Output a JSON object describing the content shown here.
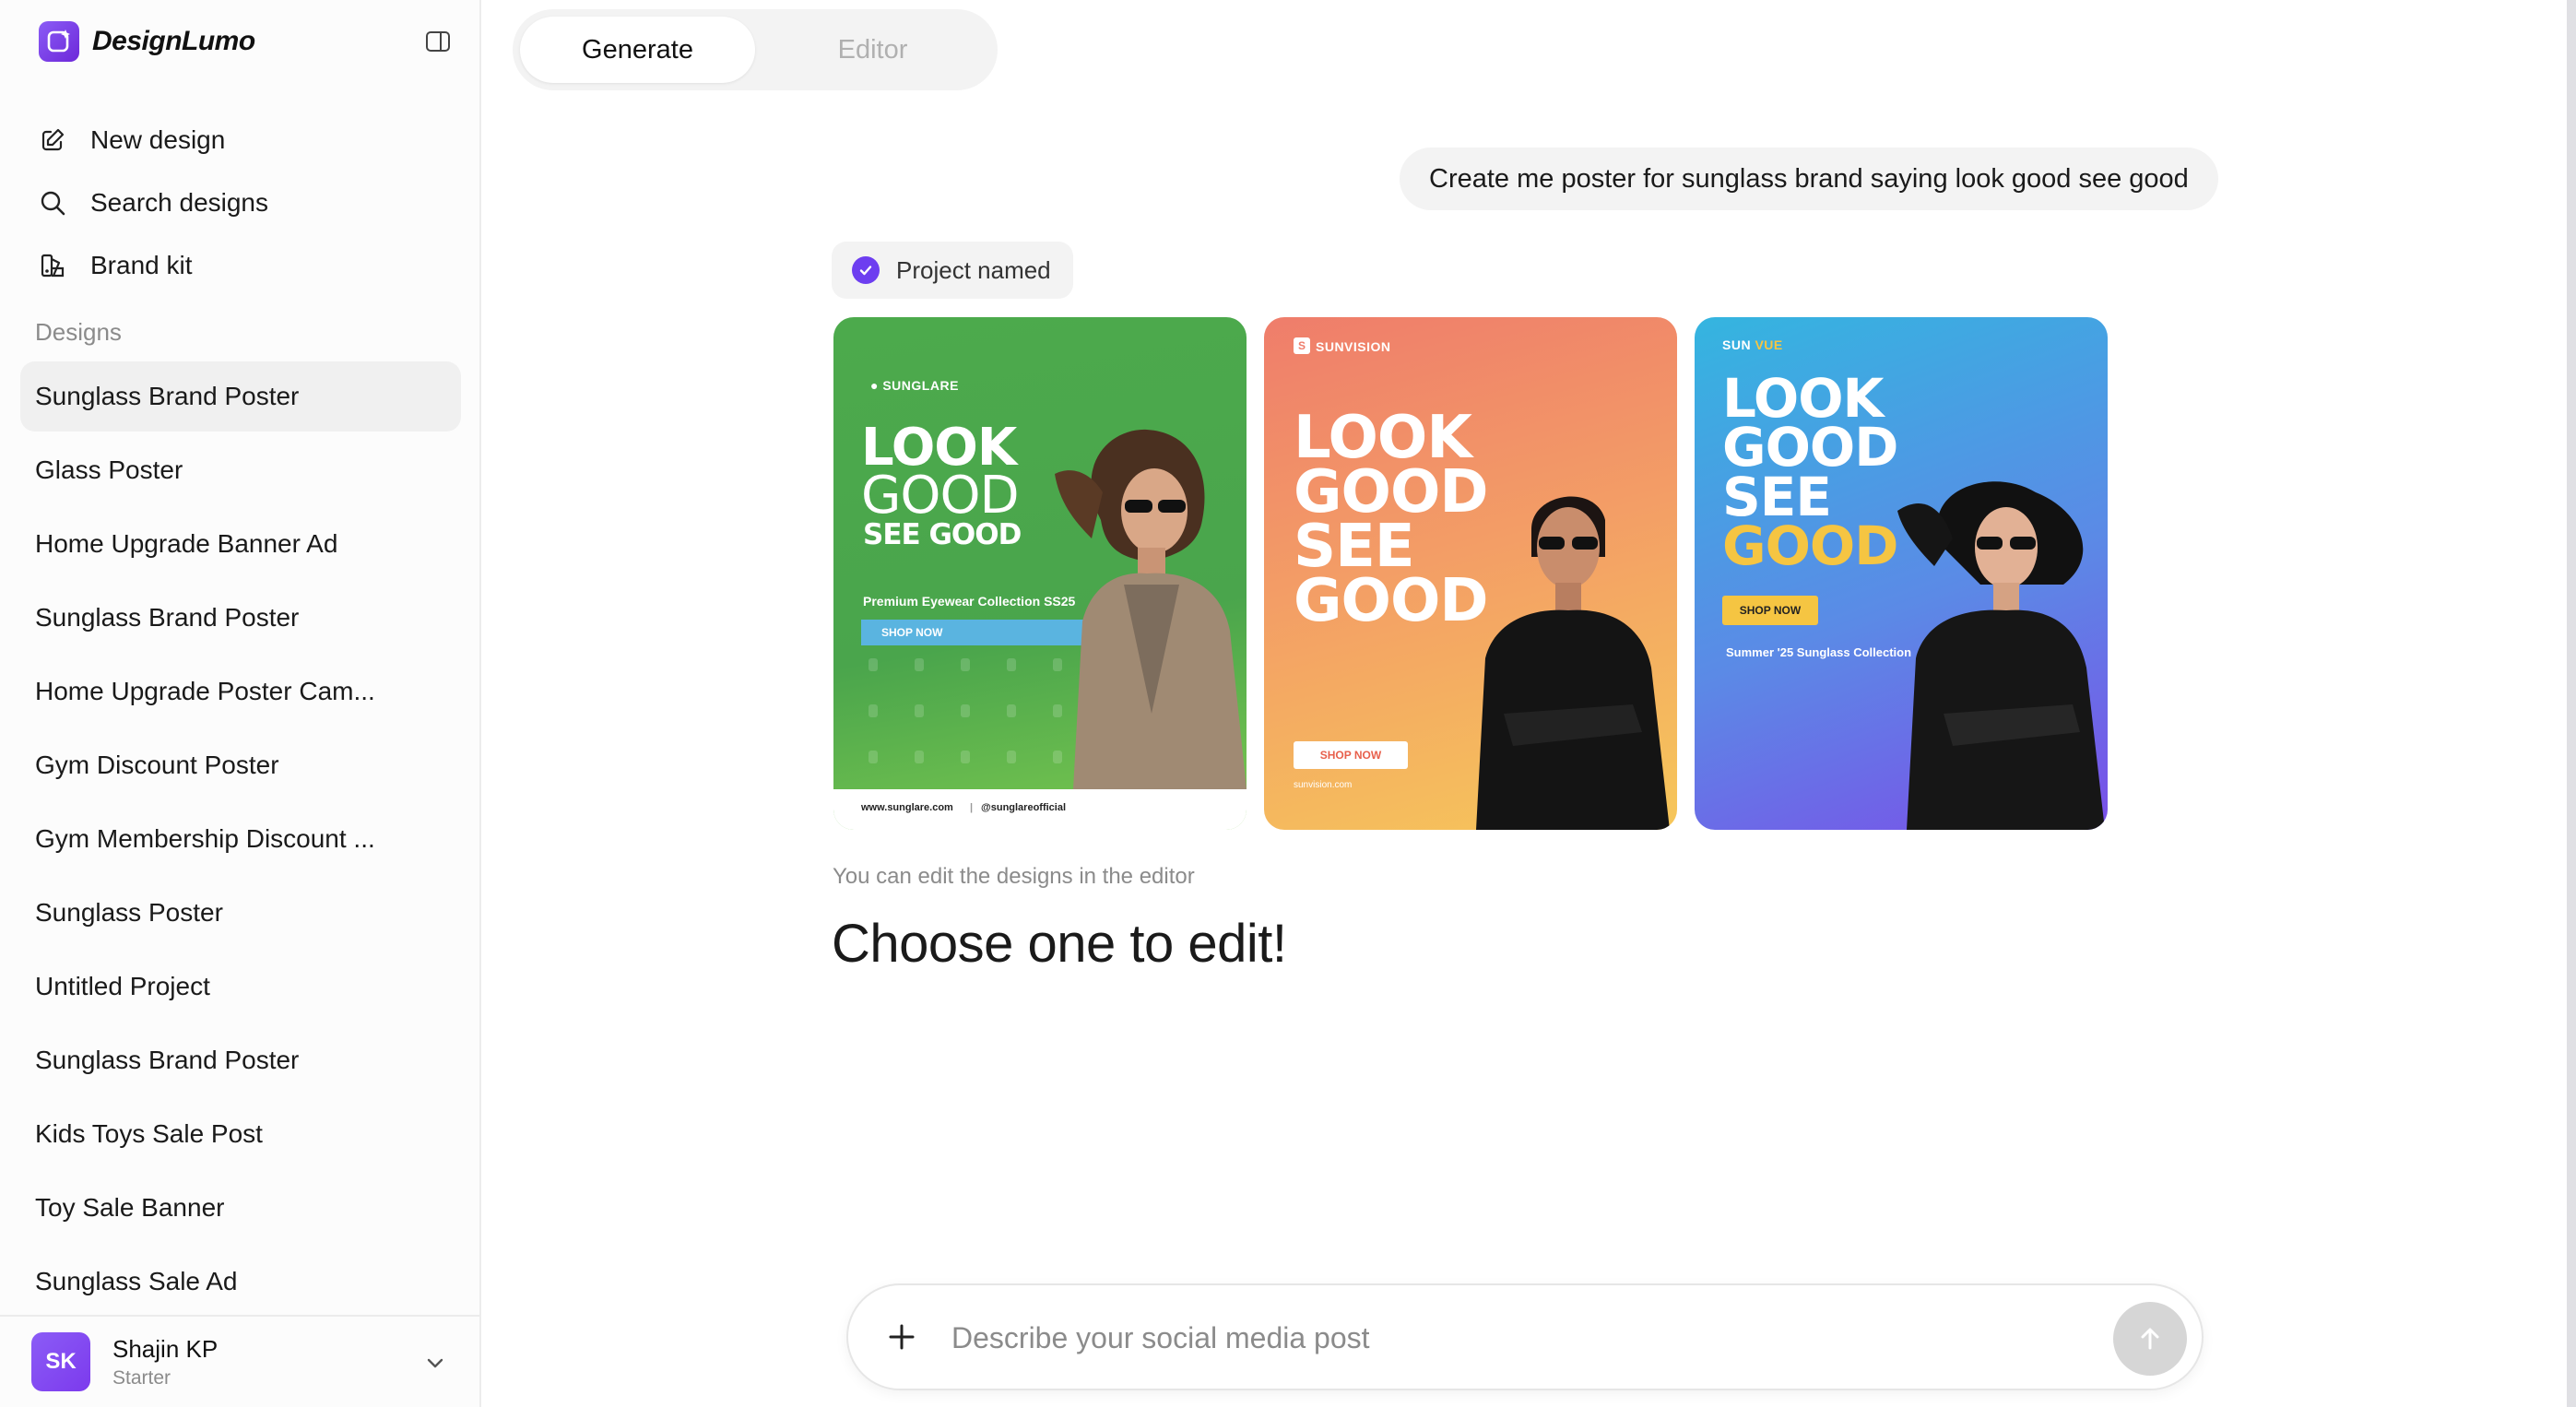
{
  "app": {
    "name": "DesignLumo"
  },
  "sidebar": {
    "nav": [
      {
        "label": "New design",
        "icon": "edit-icon"
      },
      {
        "label": "Search designs",
        "icon": "search-icon"
      },
      {
        "label": "Brand kit",
        "icon": "brand-kit-icon"
      }
    ],
    "designs_heading": "Designs",
    "designs": [
      "Sunglass Brand Poster",
      "Glass Poster",
      "Home Upgrade Banner Ad",
      "Sunglass Brand Poster",
      "Home Upgrade Poster Cam...",
      "Gym Discount Poster",
      "Gym Membership Discount ...",
      "Sunglass Poster",
      "Untitled Project",
      "Sunglass Brand Poster",
      "Kids Toys Sale Post",
      "Toy Sale Banner",
      "Sunglass Sale Ad"
    ],
    "active_index": 0
  },
  "account": {
    "initials": "SK",
    "name": "Shajin KP",
    "plan": "Starter"
  },
  "tabs": [
    {
      "label": "Generate",
      "active": true
    },
    {
      "label": "Editor",
      "active": false
    }
  ],
  "chat": {
    "user_message": "Create me poster for sunglass brand saying look good see good",
    "status": "Project named",
    "hint": "You can edit the designs in the editor",
    "prompt": "Choose one to edit!"
  },
  "posters": [
    {
      "brand": "● SUNGLARE",
      "headline": [
        "LOOK",
        "GOOD"
      ],
      "headline2": "SEE GOOD",
      "sub": "Premium Eyewear Collection SS25",
      "cta": "SHOP NOW",
      "footer_left": "www.sunglare.com",
      "footer_right": "@sunglareofficial",
      "colors": {
        "bg": "#4caa4c",
        "cta": "#5ab4e0"
      }
    },
    {
      "brand": "SUNVISION",
      "brand_mark": "S",
      "headline": [
        "LOOK",
        "GOOD",
        "SEE",
        "GOOD"
      ],
      "cta": "SHOP NOW",
      "footer": "sunvision.com",
      "colors": {
        "bg": "#f39d66",
        "cta_text": "#e8604c"
      }
    },
    {
      "brand_a": "SUN",
      "brand_b": "VUE",
      "headline": [
        "LOOK",
        "GOOD",
        "SEE"
      ],
      "headline_accent": "GOOD",
      "cta": "SHOP NOW",
      "sub": "Summer '25 Sunglass Collection",
      "colors": {
        "bg": "#5b8ae6",
        "accent": "#f5c542"
      }
    }
  ],
  "composer": {
    "placeholder": "Describe your social media post"
  },
  "colors": {
    "accent": "#7c3aed",
    "muted": "#8b8b8b"
  }
}
